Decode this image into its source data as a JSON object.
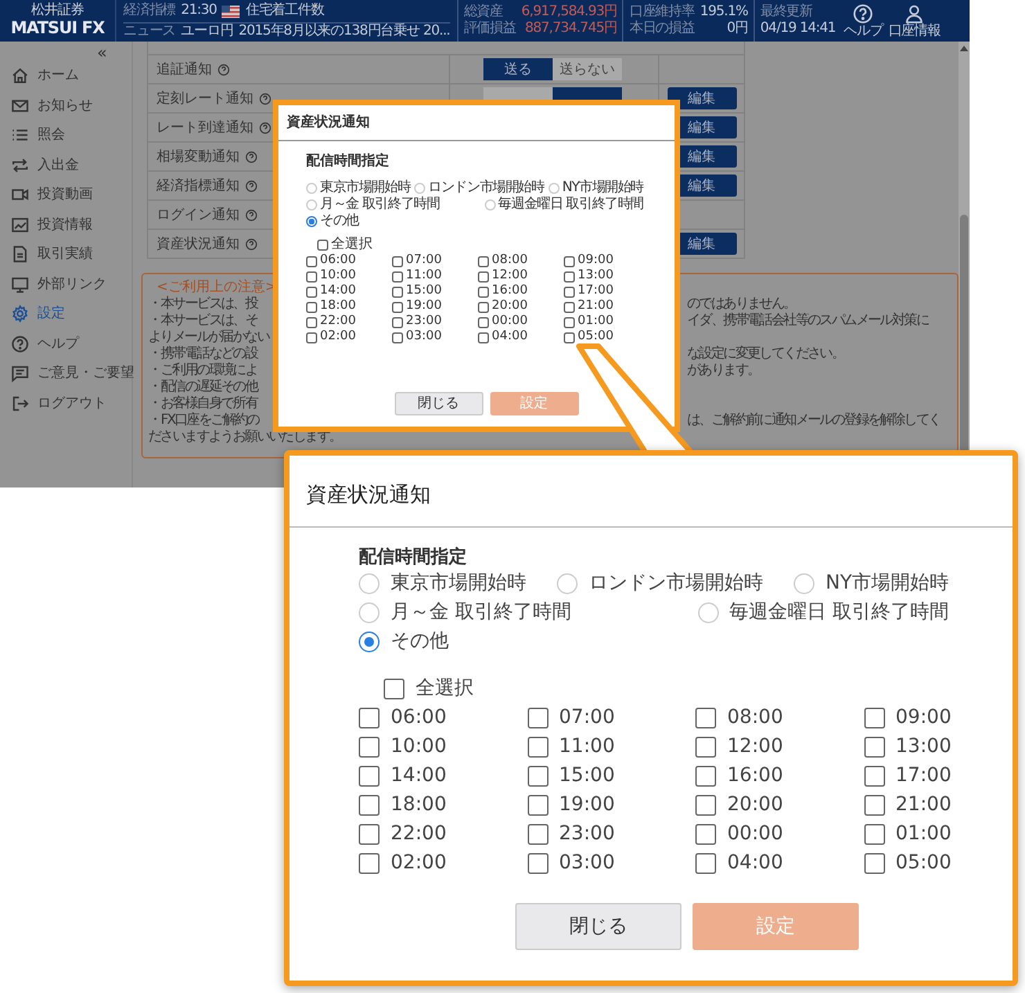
{
  "header": {
    "logo_small": "松井証券",
    "logo": "MATSUI FX",
    "ticker": [
      {
        "kind": "indicator",
        "label": "経済指標",
        "time": "21:30",
        "text": "住宅着工件数"
      },
      {
        "kind": "news",
        "label": "ニュース",
        "time": "ユーロ円",
        "text": "2015年8月以来の138円台乗せ 20..."
      }
    ],
    "assets": [
      {
        "label": "総資産",
        "value": "6,917,584.93円"
      },
      {
        "label": "評価損益",
        "value": "887,734.745円"
      }
    ],
    "margin": [
      {
        "label": "口座維持率",
        "value": "195.1%"
      },
      {
        "label": "本日の損益",
        "value": "0円"
      }
    ],
    "updated": {
      "label": "最終更新",
      "value": "04/19 14:41"
    },
    "links": [
      {
        "kind": "help",
        "label": "ヘルプ"
      },
      {
        "kind": "account",
        "label": "口座情報"
      }
    ]
  },
  "sidebar": {
    "collapse": "«",
    "items": [
      {
        "label": "ホーム",
        "selected": false
      },
      {
        "label": "お知らせ",
        "selected": false
      },
      {
        "label": "照会",
        "selected": false
      },
      {
        "label": "入出金",
        "selected": false
      },
      {
        "label": "投資動画",
        "selected": false
      },
      {
        "label": "投資情報",
        "selected": false
      },
      {
        "label": "取引実績",
        "selected": false
      },
      {
        "label": "外部リンク",
        "selected": false
      },
      {
        "label": "設定",
        "selected": true
      },
      {
        "label": "ヘルプ",
        "selected": false
      },
      {
        "label": "ご意見・ご要望",
        "selected": false
      },
      {
        "label": "ログアウト",
        "selected": false
      }
    ]
  },
  "settings_rows": [
    {
      "label": "追証通知",
      "toggle": [
        {
          "label": "送る",
          "selected": true
        },
        {
          "label": "送らない",
          "selected": false
        }
      ]
    },
    {
      "label": "定刻レート通知",
      "toggle": [
        {
          "selected": false
        },
        {
          "selected": true
        }
      ],
      "edit": "編集"
    },
    {
      "label": "レート到達通知",
      "edit": "編集"
    },
    {
      "label": "相場変動通知",
      "edit": "編集"
    },
    {
      "label": "経済指標通知",
      "edit": "編集"
    },
    {
      "label": "ログイン通知"
    },
    {
      "label": "資産状況通知",
      "edit": "編集"
    }
  ],
  "notes": {
    "title": "<ご利用上の注意>",
    "lines": [
      {
        "marker": "・",
        "left": "本サービスは、投",
        "right": "のではありません。"
      },
      {
        "marker": "・",
        "left": "本サービスは、そ",
        "right": "イダ、携帯電話会社等のスパムメール対策に"
      },
      {
        "left": "よりメールが届かない"
      },
      {
        "marker": "・",
        "left": "携帯電話などの設",
        "right": "な設定に変更してください。"
      },
      {
        "marker": "・",
        "left": "ご利用の環境によ",
        "right": "があります。"
      },
      {
        "marker": "・",
        "left": "配信の遅延その他"
      },
      {
        "marker": "・",
        "left": "お客様自身で所有"
      },
      {
        "marker": "・",
        "left": "FX口座をご解約の",
        "right": "は、ご解約前に通知メールの登録を解除してく"
      },
      {
        "left": "ださいますようお願いいたします。"
      }
    ]
  },
  "dialogs": [
    {
      "title": "資産状況通知",
      "section": "配信時間指定",
      "radio_rows": [
        [
          {
            "label": "東京市場開始時",
            "selected": false
          },
          {
            "label": "ロンドン市場開始時",
            "selected": false
          },
          {
            "label": "NY市場開始時",
            "selected": false
          }
        ],
        [
          {
            "label": "月～金 取引終了時間",
            "selected": false
          },
          {
            "label": "毎週金曜日 取引終了時間",
            "selected": false
          }
        ],
        [
          {
            "label": "その他",
            "selected": true
          }
        ]
      ],
      "select_all": {
        "label": "全選択",
        "checked": false
      },
      "times": [
        {
          "label": "06:00",
          "checked": false
        },
        {
          "label": "07:00",
          "checked": false
        },
        {
          "label": "08:00",
          "checked": false
        },
        {
          "label": "09:00",
          "checked": false
        },
        {
          "label": "10:00",
          "checked": false
        },
        {
          "label": "11:00",
          "checked": false
        },
        {
          "label": "12:00",
          "checked": false
        },
        {
          "label": "13:00",
          "checked": false
        },
        {
          "label": "14:00",
          "checked": false
        },
        {
          "label": "15:00",
          "checked": false
        },
        {
          "label": "16:00",
          "checked": false
        },
        {
          "label": "17:00",
          "checked": false
        },
        {
          "label": "18:00",
          "checked": false
        },
        {
          "label": "19:00",
          "checked": false
        },
        {
          "label": "20:00",
          "checked": false
        },
        {
          "label": "21:00",
          "checked": false
        },
        {
          "label": "22:00",
          "checked": false
        },
        {
          "label": "23:00",
          "checked": false
        },
        {
          "label": "00:00",
          "checked": false
        },
        {
          "label": "01:00",
          "checked": false
        },
        {
          "label": "02:00",
          "checked": false
        },
        {
          "label": "03:00",
          "checked": false
        },
        {
          "label": "04:00",
          "checked": false
        },
        {
          "label": "05:00",
          "checked": false
        }
      ],
      "buttons": [
        {
          "label": "閉じる",
          "kind": "secondary"
        },
        {
          "label": "設定",
          "kind": "primary",
          "disabled": true
        }
      ]
    },
    {
      "title": "資産状況通知",
      "section": "配信時間指定",
      "radio_rows": [
        [
          {
            "label": "東京市場開始時",
            "selected": false
          },
          {
            "label": "ロンドン市場開始時",
            "selected": false
          },
          {
            "label": "NY市場開始時",
            "selected": false
          }
        ],
        [
          {
            "label": "月～金 取引終了時間",
            "selected": false
          },
          {
            "label": "毎週金曜日 取引終了時間",
            "selected": false
          }
        ],
        [
          {
            "label": "その他",
            "selected": true
          }
        ]
      ],
      "select_all": {
        "label": "全選択",
        "checked": false
      },
      "times": [
        {
          "label": "06:00",
          "checked": false
        },
        {
          "label": "07:00",
          "checked": false
        },
        {
          "label": "08:00",
          "checked": false
        },
        {
          "label": "09:00",
          "checked": false
        },
        {
          "label": "10:00",
          "checked": false
        },
        {
          "label": "11:00",
          "checked": false
        },
        {
          "label": "12:00",
          "checked": false
        },
        {
          "label": "13:00",
          "checked": false
        },
        {
          "label": "14:00",
          "checked": false
        },
        {
          "label": "15:00",
          "checked": false
        },
        {
          "label": "16:00",
          "checked": false
        },
        {
          "label": "17:00",
          "checked": false
        },
        {
          "label": "18:00",
          "checked": false
        },
        {
          "label": "19:00",
          "checked": false
        },
        {
          "label": "20:00",
          "checked": false
        },
        {
          "label": "21:00",
          "checked": false
        },
        {
          "label": "22:00",
          "checked": false
        },
        {
          "label": "23:00",
          "checked": false
        },
        {
          "label": "00:00",
          "checked": false
        },
        {
          "label": "01:00",
          "checked": false
        },
        {
          "label": "02:00",
          "checked": false
        },
        {
          "label": "03:00",
          "checked": false
        },
        {
          "label": "04:00",
          "checked": false
        },
        {
          "label": "05:00",
          "checked": false
        }
      ],
      "buttons": [
        {
          "label": "閉じる",
          "kind": "secondary"
        },
        {
          "label": "設定",
          "kind": "primary",
          "disabled": true
        }
      ]
    }
  ]
}
